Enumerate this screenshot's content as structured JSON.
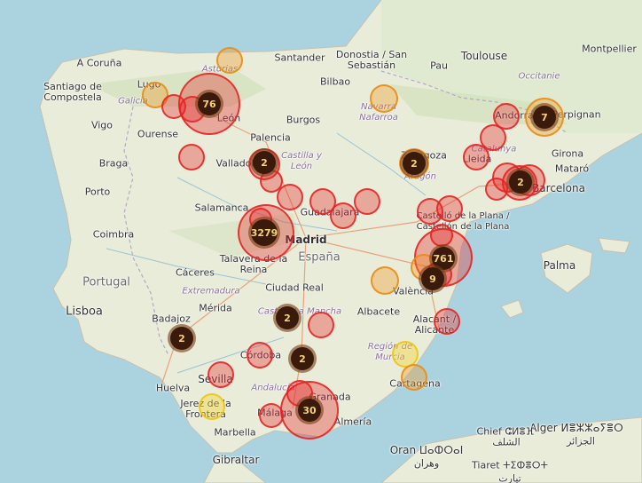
{
  "countries": {
    "portugal": "Portugal",
    "espana": "España"
  },
  "cities": {
    "a_coruna": "A Coruña",
    "santiago": "Santiago de Compostela",
    "lugo": "Lugo",
    "vigo": "Vigo",
    "ourense": "Ourense",
    "braga": "Braga",
    "porto": "Porto",
    "coimbra": "Coimbra",
    "lisboa": "Lisboa",
    "santander": "Santander",
    "donostia": "Donostia / San Sebastián",
    "pau": "Pau",
    "toulouse": "Toulouse",
    "montpellier": "Montpellier",
    "bilbao": "Bilbao",
    "burgos": "Burgos",
    "leon": "León",
    "palencia": "Palencia",
    "valladolid": "Valladolid",
    "zaragoza": "Zaragoza",
    "lleida": "Lleida",
    "girona": "Girona",
    "mataro": "Mataró",
    "barcelona": "Barcelona",
    "perpignan": "Perpignan",
    "andorra": "Andorra",
    "salamanca": "Salamanca",
    "madrid": "Madrid",
    "guadalajara": "Guadalajara",
    "castello": "Castelló de la Plana / Castellón de la Plana",
    "palma": "Palma",
    "caceres": "Cáceres",
    "talavera": "Talavera de la Reina",
    "ciudad_real": "Ciudad Real",
    "merida": "Mérida",
    "badajoz": "Badajoz",
    "albacete": "Albacete",
    "alacant": "Alacant / Alicante",
    "valencia": "València",
    "murcia": "Región de Murcia",
    "cartagena": "Cartagena",
    "cordoba": "Córdoba",
    "sevilla": "Sevilla",
    "huelva": "Huelva",
    "jerez": "Jerez de la Frontera",
    "granada": "Granada",
    "malaga": "Málaga",
    "marbella": "Marbella",
    "almeria": "Almería",
    "gibraltar": "Gibraltar",
    "oran": "Oran ⵡⴰⵀⵔⴰⵏ",
    "oran_ar": "وهران",
    "alger": "Alger ⵍⴻⵣⵣⴰⵢⴻⵔ",
    "alger_ar": "الجزائر",
    "chlef": "Chief ⵛⵍⴻⴼ",
    "chlef_ar": "الشلف",
    "tiaret": "Tiaret ⵜⵉⵀⴻⵔⵜ",
    "tiaret_ar": "تيارت"
  },
  "regions": {
    "asturias": "Asturias",
    "galicia": "Galicia",
    "navarra": "Navarra Nafarroa",
    "occitanie": "Occitanie",
    "catalunya": "Catalunya",
    "aragon": "Aragón",
    "castilla_leon": "Castilla y León",
    "extremadura": "Extremadura",
    "castilla_mancha": "Castilla-La Mancha",
    "andalucia": "Andalucía"
  },
  "clusters": [
    {
      "id": "c76",
      "count": "76"
    },
    {
      "id": "c2_valladolid",
      "count": "2"
    },
    {
      "id": "c3279",
      "count": "3279"
    },
    {
      "id": "c2_zaragoza",
      "count": "2"
    },
    {
      "id": "c7",
      "count": "7"
    },
    {
      "id": "c2_barcelona",
      "count": "2"
    },
    {
      "id": "c761",
      "count": "761"
    },
    {
      "id": "c9",
      "count": "9"
    },
    {
      "id": "c2_cr",
      "count": "2"
    },
    {
      "id": "c2_badajoz",
      "count": "2"
    },
    {
      "id": "c2_jaen",
      "count": "2"
    },
    {
      "id": "c30",
      "count": "30"
    }
  ],
  "colors": {
    "sea": "#aad3df",
    "land": "#e8ecd9",
    "red_marker": "#e62828",
    "orange_marker": "#eb8c14",
    "yellow_marker": "#ebc814",
    "cluster_fill": "#3a1a0a"
  }
}
